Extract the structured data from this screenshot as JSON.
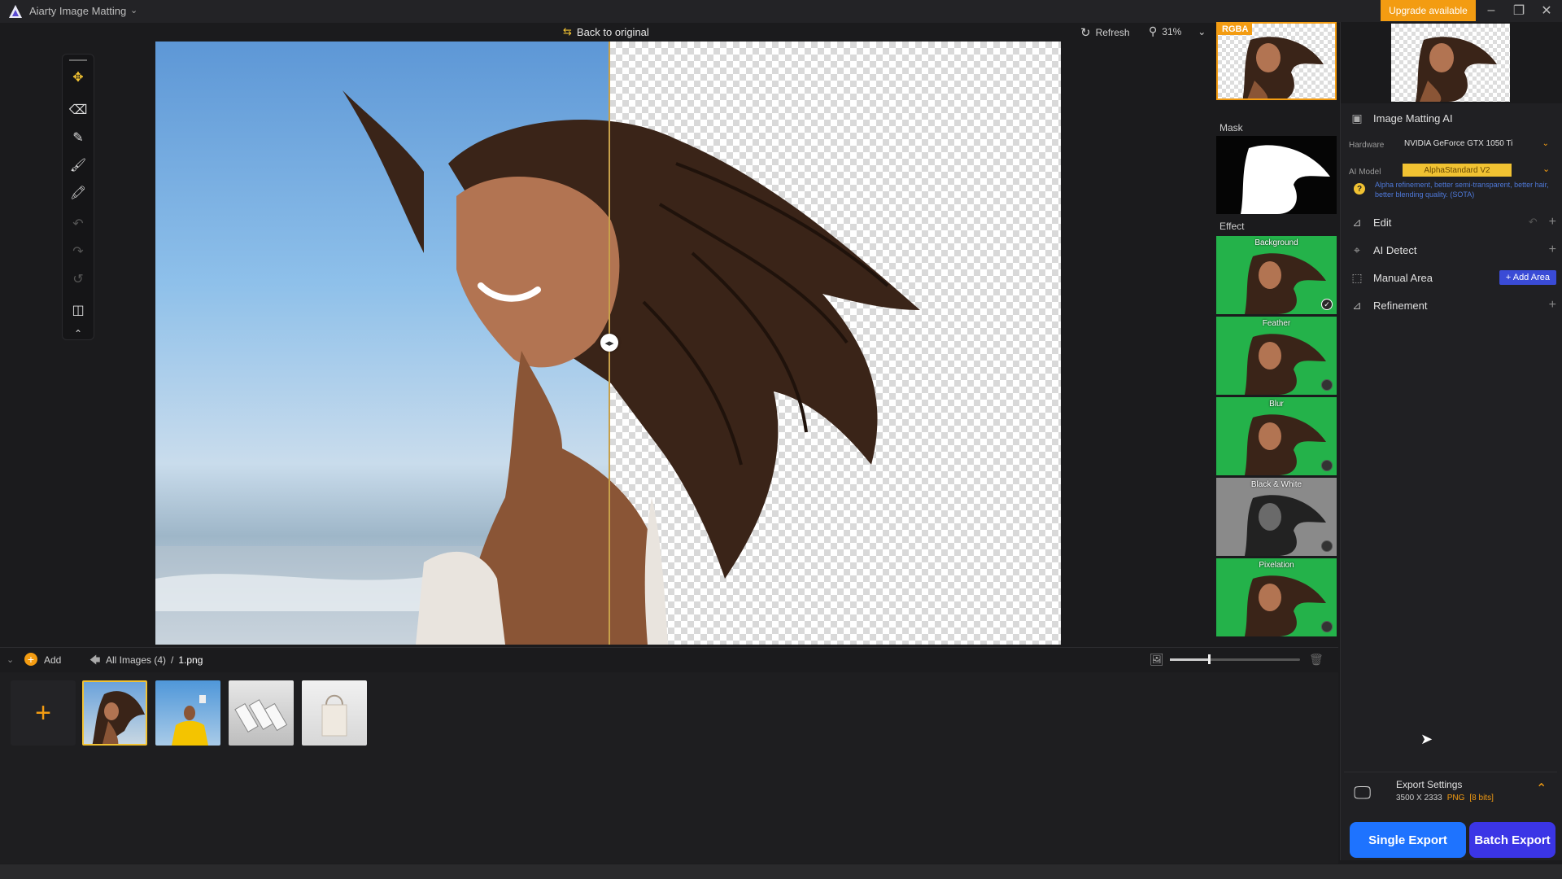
{
  "app": {
    "title": "Aiarty Image Matting",
    "upgrade_label": "Upgrade available"
  },
  "canvas_header": {
    "back_to_original": "Back to original",
    "refresh": "Refresh",
    "zoom": "31%"
  },
  "preview": {
    "rgba_badge": "RGBA",
    "mask_label": "Mask",
    "effect_label": "Effect",
    "effects": [
      {
        "name": "Background",
        "selected": true
      },
      {
        "name": "Feather",
        "selected": false
      },
      {
        "name": "Blur",
        "selected": false
      },
      {
        "name": "Black & White",
        "selected": false
      },
      {
        "name": "Pixelation",
        "selected": false
      }
    ]
  },
  "right_panel": {
    "image_matting_ai": "Image Matting AI",
    "hardware_label": "Hardware",
    "hardware_value": "NVIDIA GeForce GTX 1050 Ti",
    "ai_model_label": "AI Model",
    "ai_model_value": "AlphaStandard  V2",
    "model_note": "Alpha refinement, better semi-transparent, better hair, better blending quality. (SOTA)",
    "edit": "Edit",
    "ai_detect": "AI Detect",
    "manual_area": "Manual Area",
    "add_area": "+ Add Area",
    "refinement": "Refinement",
    "export_settings_title": "Export Settings",
    "export_size": "3500 X 2333",
    "export_format": "PNG",
    "export_bits": "[8 bits]",
    "single_export": "Single Export",
    "batch_export": "Batch Export"
  },
  "filmstrip": {
    "add_label": "Add",
    "breadcrumb_root": "All Images (4)",
    "breadcrumb_sep": "/",
    "current_file": "1.png",
    "zoom_slider_value": 0.3
  },
  "colors": {
    "accent_orange": "#f39c12",
    "export_blue": "#1e73ff",
    "batch_purple": "#3b35e6",
    "effect_green": "#24b24a"
  }
}
